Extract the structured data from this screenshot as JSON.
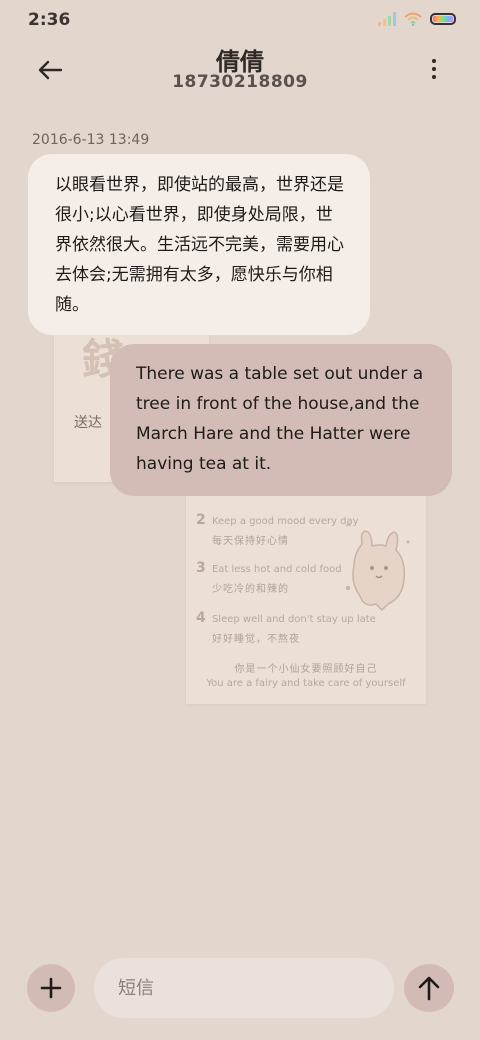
{
  "status_bar": {
    "time": "2:36",
    "icons": [
      "signal-icon",
      "wifi-icon",
      "battery-icon"
    ]
  },
  "header": {
    "back_icon": "arrow-left-icon",
    "contact_name": "倩倩",
    "contact_number": "18730218809",
    "more_icon": "more-vertical-icon"
  },
  "conversation": {
    "timestamp": "2016-6-13 13:49",
    "messages": [
      {
        "direction": "received",
        "text": "以眼看世界，即使站的最高，世界还是很小;以心看世界，即使身处局限，世界依然很大。生活远不完美，需要用心去体会;无需拥有太多，愿快乐与你相随。"
      },
      {
        "direction": "sent",
        "text": "There was a table set out under a tree in front of the house,and the March Hare and the Hatter were having tea at it."
      }
    ]
  },
  "background_image": {
    "card_glyph": "錢",
    "card_label": "送达",
    "tips": [
      {
        "num": "2",
        "en": "Keep a good mood every day",
        "cn": "每天保持好心情"
      },
      {
        "num": "3",
        "en": "Eat less hot and cold food",
        "cn": "少吃冷的和辣的"
      },
      {
        "num": "4",
        "en": "Sleep well and don't stay up late",
        "cn": "好好睡觉，不熬夜"
      }
    ],
    "footer_cn": "你是一个小仙女要照顾好自己",
    "footer_en": "You are a fairy and take care of yourself"
  },
  "input_bar": {
    "add_icon": "plus-icon",
    "placeholder": "短信",
    "value": "",
    "send_icon": "arrow-up-icon"
  },
  "colors": {
    "background": "#e3d6cd",
    "received_bubble": "#f5eee8",
    "sent_bubble": "#d3bcb5",
    "button_bg": "#d3bbb5"
  }
}
